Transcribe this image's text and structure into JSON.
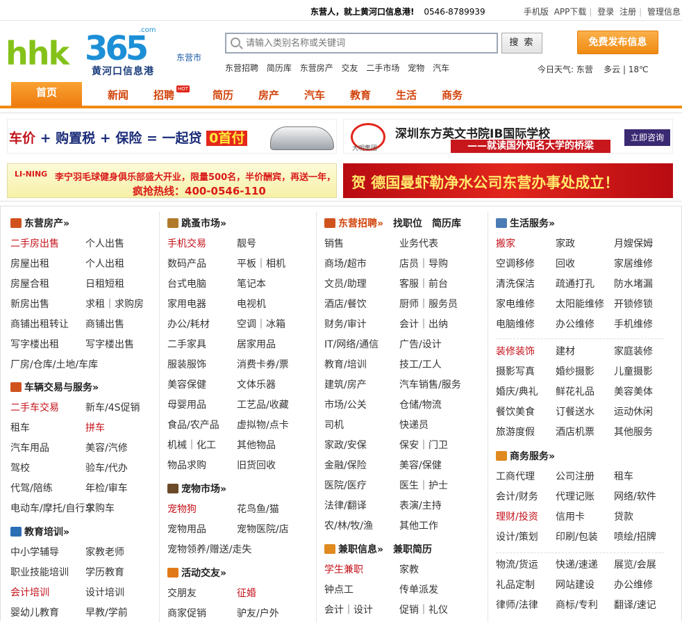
{
  "topbar": {
    "promo": "东营人，就上黄河口信息港!",
    "phone": "0546-8789939",
    "links": [
      "手机版",
      "APP下载",
      "登录",
      "注册",
      "管理信息"
    ]
  },
  "logo": {
    "main": "hhk",
    "digits": "365",
    "domain": ".com",
    "subtitle": "黄河口信息港"
  },
  "city": "东营市",
  "search": {
    "placeholder": "请输入类别名称或关键词",
    "button": "搜 索"
  },
  "hotwords": [
    "东营招聘",
    "简历库",
    "东营房产",
    "交友",
    "二手市场",
    "宠物",
    "汽车"
  ],
  "publish_button": "免费发布信息",
  "weather": {
    "label": "今日天气:",
    "city": "东营",
    "condition": "多云",
    "temp": "18℃"
  },
  "nav": {
    "home": "首页",
    "items": [
      "新闻",
      "招聘",
      "简历",
      "房产",
      "汽车",
      "教育",
      "生活",
      "商务"
    ],
    "hot_badge": "HOT"
  },
  "ads": {
    "ad1": {
      "a": "车价",
      "b": "+ 购置税 + 保险 = 一起贷",
      "c": "0首付"
    },
    "ad2": {
      "brand": "大明集团",
      "title": "深圳东方英文书院IB国际学校",
      "slogan": "——就读国外知名大学的桥梁",
      "button": "立即咨询"
    },
    "ad3": {
      "logo": "LI-NING",
      "line1": "李宁羽毛球健身俱乐部盛大开业，限量500名，半价酬宾，再送一年，……",
      "line2": "疯抢热线：400-0546-110"
    },
    "ad4": {
      "text": "贺 德国曼虾勒净水公司东营办事处成立！"
    }
  },
  "colors": {
    "accent": "#f08a12",
    "nav_text": "#d2440c",
    "link_red": "#c4131b"
  },
  "sections": {
    "realestate": {
      "title": "东营房产»",
      "icon": "house-icon",
      "rows": [
        [
          "二手房出售",
          "个人出售"
        ],
        [
          "房屋出租",
          "个人出租"
        ],
        [
          "房屋合租",
          "日租短租"
        ],
        [
          "新房出售",
          "求租｜求购房"
        ],
        [
          "商铺出租转让",
          "商铺出售"
        ],
        [
          "写字楼出租",
          "写字楼出售"
        ],
        [
          "厂房/仓库/土地/车库",
          ""
        ]
      ]
    },
    "vehicles": {
      "title": "车辆交易与服务»",
      "icon": "car-icon",
      "rows": [
        [
          "二手车交易",
          "新车/4S促销"
        ],
        [
          "租车",
          "拼车"
        ],
        [
          "汽车用品",
          "美容/汽修"
        ],
        [
          "驾校",
          "验车/代办"
        ],
        [
          "代驾/陪练",
          "年检/审车"
        ],
        [
          "电动车/摩托/自行车",
          "求购车"
        ]
      ]
    },
    "education": {
      "title": "教育培训»",
      "icon": "education-icon",
      "rows": [
        [
          "中小学辅导",
          "家教老师"
        ],
        [
          "职业技能培训",
          "学历教育"
        ],
        [
          "会计培训",
          "设计培训"
        ],
        [
          "婴幼儿教育",
          "早教/学前"
        ]
      ]
    },
    "flea": {
      "title": "跳蚤市场»",
      "icon": "bag-icon",
      "rows": [
        [
          "手机交易",
          "靓号"
        ],
        [
          "数码产品",
          "平板｜相机"
        ],
        [
          "台式电脑",
          "笔记本"
        ],
        [
          "家用电器",
          "电视机"
        ],
        [
          "办公/耗材",
          "空调｜冰箱"
        ],
        [
          "二手家具",
          "居家用品"
        ],
        [
          "服装服饰",
          "消费卡券/票"
        ],
        [
          "美容保健",
          "文体乐器"
        ],
        [
          "母婴用品",
          "工艺品/收藏"
        ],
        [
          "食品/农产品",
          "虚拟物/点卡"
        ],
        [
          "机械｜化工",
          "其他物品"
        ],
        [
          "物品求购",
          "旧货回收"
        ]
      ]
    },
    "pets": {
      "title": "宠物市场»",
      "icon": "paw-icon",
      "rows": [
        [
          "宠物狗",
          "花鸟鱼/猫"
        ],
        [
          "宠物用品",
          "宠物医院/店"
        ],
        [
          "宠物领养/赠送/走失",
          ""
        ]
      ]
    },
    "social": {
      "title": "活动交友»",
      "icon": "people-icon",
      "rows": [
        [
          "交朋友",
          "征婚"
        ],
        [
          "商家促销",
          "驴友/户外"
        ]
      ]
    },
    "jobs": {
      "title": "东营招聘»",
      "extra1": "找职位",
      "extra2": "简历库",
      "icon": "jobs-icon",
      "rows": [
        [
          "销售",
          "业务代表"
        ],
        [
          "商场/超市",
          "店员｜导购"
        ],
        [
          "文员/助理",
          "客服｜前台"
        ],
        [
          "酒店/餐饮",
          "厨师｜服务员"
        ],
        [
          "财务/审计",
          "会计｜出纳"
        ],
        [
          "IT/网络/通信",
          "广告/设计"
        ],
        [
          "教育/培训",
          "技工/工人"
        ],
        [
          "建筑/房产",
          "汽车销售/服务"
        ],
        [
          "市场/公关",
          "仓储/物流"
        ],
        [
          "司机",
          "快递员"
        ],
        [
          "家政/安保",
          "保安｜门卫"
        ],
        [
          "金融/保险",
          "美容/保健"
        ],
        [
          "医院/医疗",
          "医生｜护士"
        ],
        [
          "法律/翻译",
          "表演/主持"
        ],
        [
          "农/林/牧/渔",
          "其他工作"
        ]
      ]
    },
    "parttime": {
      "title": "兼职信息»",
      "extra1": "兼职简历",
      "icon": "handshake-icon",
      "rows": [
        [
          "学生兼职",
          "家教"
        ],
        [
          "钟点工",
          "传单派发"
        ],
        [
          "会计｜设计",
          "促销｜礼仪"
        ]
      ]
    },
    "life": {
      "title": "生活服务»",
      "icon": "phone-icon",
      "rows": [
        [
          "搬家",
          "家政",
          "月嫂保姆"
        ],
        [
          "空调移修",
          "回收",
          "家居维修"
        ],
        [
          "清洗保洁",
          "疏通打孔",
          "防水堵漏"
        ],
        [
          "家电维修",
          "太阳能维修",
          "开锁修锁"
        ],
        [
          "电脑维修",
          "办公维修",
          "手机维修"
        ]
      ],
      "rows2": [
        [
          "装修装饰",
          "建材",
          "家庭装修"
        ],
        [
          "摄影写真",
          "婚纱摄影",
          "儿童摄影"
        ],
        [
          "婚庆/典礼",
          "鲜花礼品",
          "美容美体"
        ],
        [
          "餐饮美食",
          "订餐送水",
          "运动休闲"
        ],
        [
          "旅游度假",
          "酒店机票",
          "其他服务"
        ]
      ]
    },
    "business": {
      "title": "商务服务»",
      "icon": "handshake-icon",
      "rows": [
        [
          "工商代理",
          "公司注册",
          "租车"
        ],
        [
          "会计/财务",
          "代理记账",
          "网络/软件"
        ],
        [
          "理财/投资",
          "信用卡",
          "贷款"
        ],
        [
          "设计/策划",
          "印刷/包装",
          "喷绘/招牌"
        ]
      ],
      "rows2": [
        [
          "物流/货运",
          "快递/速递",
          "展览/会展"
        ],
        [
          "礼品定制",
          "网站建设",
          "办公维修"
        ],
        [
          "律师/法律",
          "商标/专利",
          "翻译/速记"
        ]
      ]
    }
  }
}
